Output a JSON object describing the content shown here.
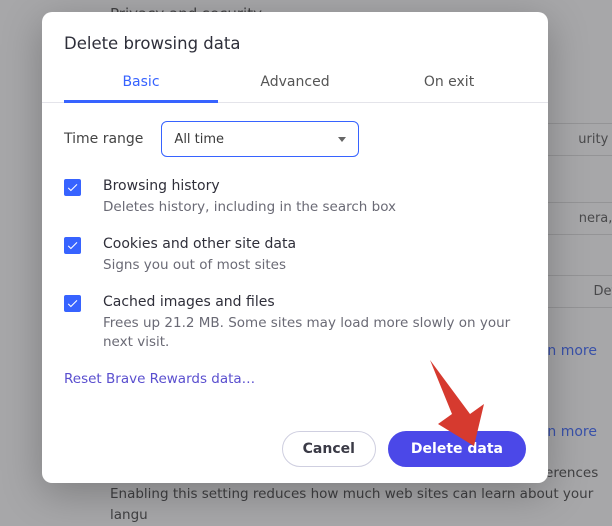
{
  "bg": {
    "title": "Privacy and security",
    "row1": "urity setti",
    "row2": "nera, pop",
    "row3_left": "",
    "row3_right": "Default",
    "more1": "n more",
    "more2": "n more",
    "foot1": "Prevent sites from fingerprinting me based on my language preferences",
    "foot2": "Enabling this setting reduces how much web sites can learn about your langu"
  },
  "modal": {
    "title": "Delete browsing data",
    "tabs": {
      "basic": "Basic",
      "advanced": "Advanced",
      "onexit": "On exit"
    },
    "range_label": "Time range",
    "range_value": "All time",
    "items": [
      {
        "title": "Browsing history",
        "desc": "Deletes history, including in the search box"
      },
      {
        "title": "Cookies and other site data",
        "desc": "Signs you out of most sites"
      },
      {
        "title": "Cached images and files",
        "desc": "Frees up 21.2 MB. Some sites may load more slowly on your next visit."
      }
    ],
    "reset": "Reset Brave Rewards data…",
    "cancel": "Cancel",
    "delete": "Delete data"
  }
}
